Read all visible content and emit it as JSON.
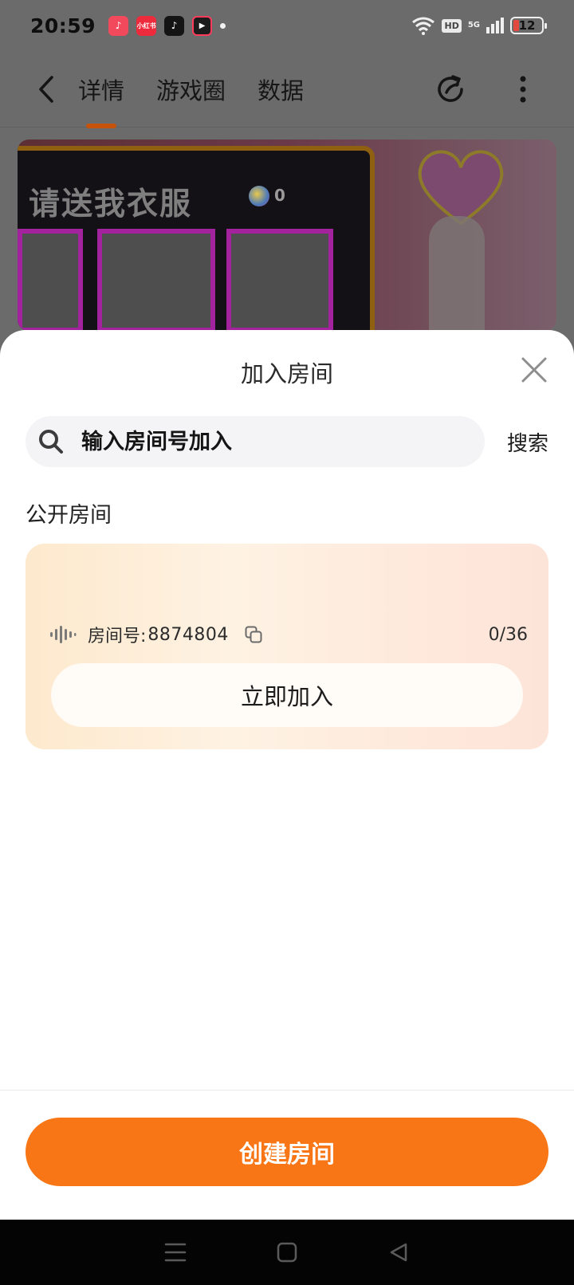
{
  "status_bar": {
    "time": "20:59",
    "app_icons": [
      {
        "name": "music-app-icon",
        "color": "#f2495c",
        "glyph": "♪"
      },
      {
        "name": "xiaohongshu-app-icon",
        "color": "#ee2b3c",
        "glyph": "小红书"
      },
      {
        "name": "tiktok-app-icon",
        "color": "#141414",
        "glyph": "♪"
      },
      {
        "name": "video-record-app-icon",
        "color": "#1c1c1c",
        "glyph": "▶"
      }
    ],
    "hd_badge": "HD",
    "network": "5G",
    "battery_level": "12"
  },
  "top_nav": {
    "tabs": [
      {
        "label": "详情",
        "active": true
      },
      {
        "label": "游戏圈",
        "active": false
      },
      {
        "label": "数据",
        "active": false
      }
    ],
    "accent_color": "#c6520c"
  },
  "banner": {
    "board_title": "请送我衣服",
    "coin_count": "0"
  },
  "sheet": {
    "title": "加入房间",
    "search": {
      "placeholder": "输入房间号加入",
      "value": "",
      "button_label": "搜索"
    },
    "section_label": "公开房间",
    "rooms": [
      {
        "id_label": "房间号:",
        "id": "8874804",
        "count": "0/36",
        "join_label": "立即加入"
      }
    ],
    "create_button_label": "创建房间",
    "create_button_color": "#f97617"
  }
}
